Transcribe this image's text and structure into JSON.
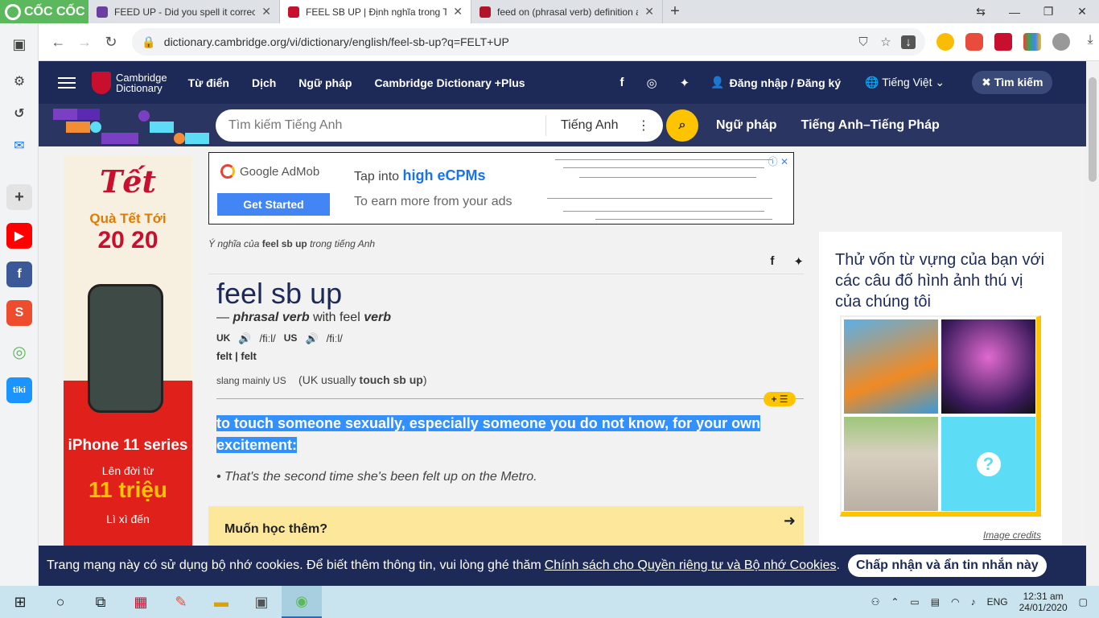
{
  "browser": {
    "brand": "CỐC CỐC",
    "tabs": [
      {
        "title": "FEED UP - Did you spell it correctly"
      },
      {
        "title": "FEEL SB UP | Định nghĩa trong Từ điể"
      },
      {
        "title": "feed on (phrasal verb) definition ar"
      }
    ],
    "url": "dictionary.cambridge.org/vi/dictionary/english/feel-sb-up?q=FELT+UP"
  },
  "site": {
    "logo_line1": "Cambridge",
    "logo_line2": "Dictionary",
    "nav": [
      "Từ điển",
      "Dịch",
      "Ngữ pháp",
      "Cambridge Dictionary +Plus"
    ],
    "signin": "Đăng nhập / Đăng ký",
    "language": "Tiếng Việt",
    "search_button": "Tìm kiếm",
    "search_placeholder": "Tìm kiếm Tiếng Anh",
    "search_lang": "Tiếng Anh",
    "sublinks": [
      "Ngữ pháp",
      "Tiếng Anh–Tiếng Pháp"
    ]
  },
  "left_ad": {
    "title": "Tết",
    "subtitle": "Quà Tết Tới",
    "amount": "20 20",
    "series": "iPhone 11 series",
    "up_to": "Lên đời từ",
    "price": "11 triệu",
    "bonus": "Lì xì đến"
  },
  "banner_ad": {
    "brand": "Google AdMob",
    "button": "Get Started",
    "tap_prefix": "Tap into",
    "tap_highlight": "high eCPMs",
    "earn": "To earn more from your ads"
  },
  "entry": {
    "breadcrumb_prefix": "Ý nghĩa của",
    "breadcrumb_word": "feel sb up",
    "breadcrumb_suffix": "trong tiếng Anh",
    "headword": "feel sb up",
    "pos_dash": "—",
    "pos": "phrasal verb",
    "pos_with": "with feel",
    "pos_verb": "verb",
    "uk_label": "UK",
    "uk_ipa": "/fiːl/",
    "us_label": "US",
    "us_ipa": "/fiːl/",
    "inflection1": "felt",
    "inflection2": "felt",
    "usage": "slang mainly US",
    "uk_alt_prefix": "(UK usually",
    "uk_alt_word": "touch sb up",
    "uk_alt_suffix": ")",
    "definition": "to touch someone sexually, especially someone you do not know, for your own excitement:",
    "example": "That's the second time she's been felt up on the Metro.",
    "learn_more": "Muốn học thêm?"
  },
  "quiz": {
    "title": "Thử vốn từ vựng của bạn với các câu đố hình ảnh thú vị của chúng tôi",
    "credits": "Image credits",
    "question_mark": "?"
  },
  "cookie": {
    "text": "Trang mạng này có sử dụng bộ nhớ cookies. Để biết thêm thông tin, vui lòng ghé thăm",
    "link": "Chính sách cho Quyền riêng tư và Bộ nhớ Cookies",
    "period": ".",
    "accept": "Chấp nhận và ẩn tin nhắn này"
  },
  "taskbar": {
    "lang": "ENG",
    "time": "12:31 am",
    "date": "24/01/2020"
  },
  "colors": {
    "cambridge_navy": "#1d2a57",
    "accent_yellow": "#fec400",
    "highlight_blue": "#3390ff"
  }
}
